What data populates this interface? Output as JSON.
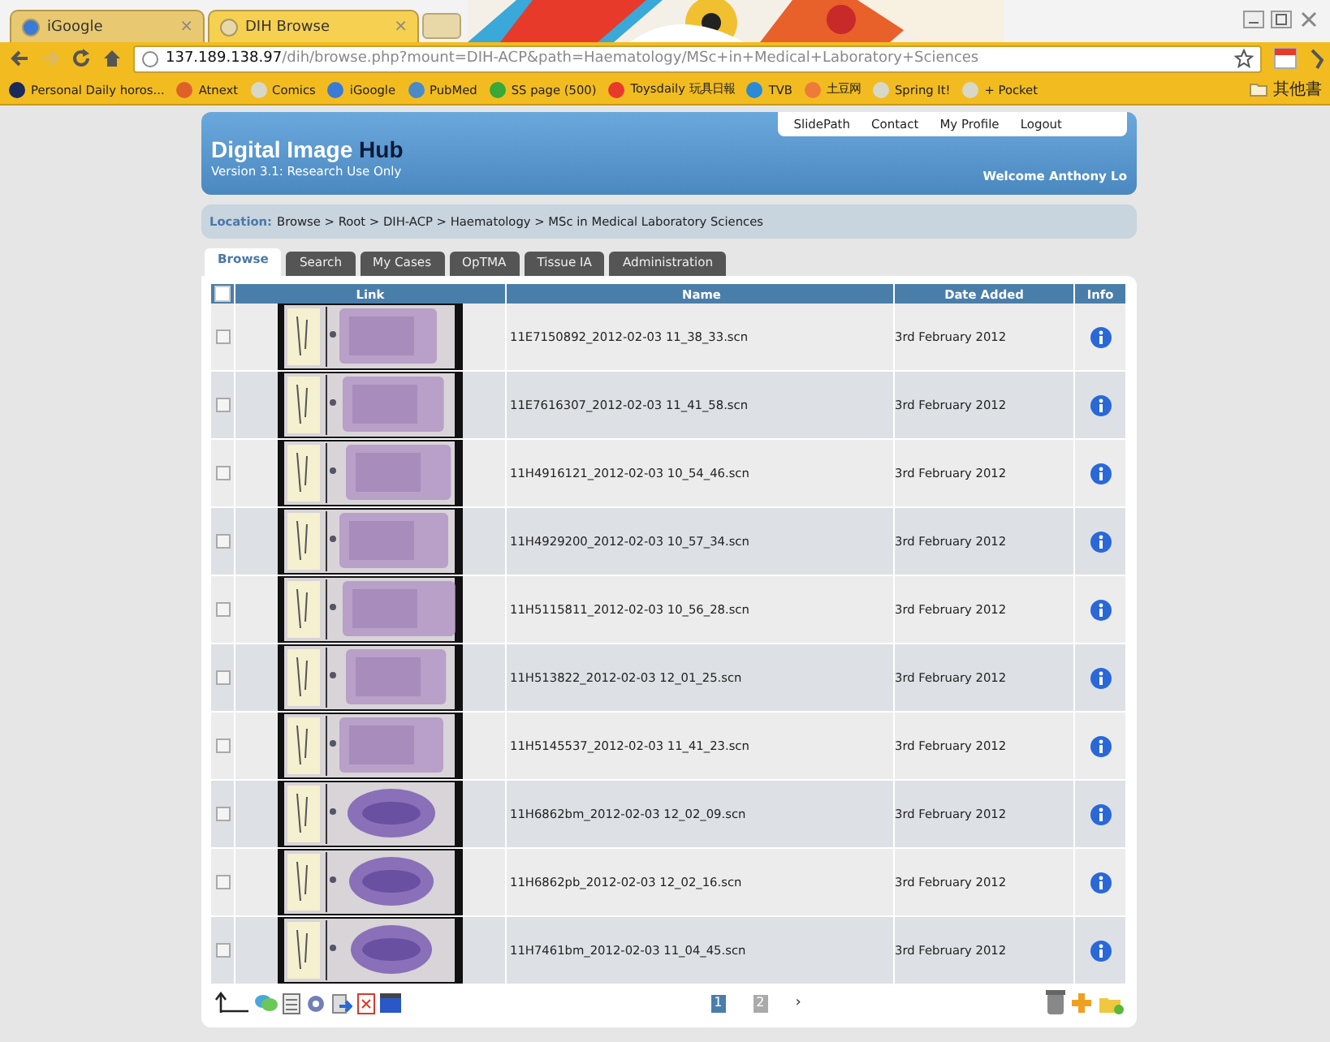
{
  "browser": {
    "tabs": [
      {
        "label": "iGoogle",
        "close": "×",
        "selected": false
      },
      {
        "label": "DIH Browse",
        "close": "×",
        "selected": true
      }
    ],
    "address": {
      "host": "137.189.138.97",
      "path": "/dih/browse.php?mount=DIH-ACP&path=Haematology/MSc+in+Medical+Laboratory+Sciences"
    },
    "bookmarks": [
      {
        "label": "Personal Daily horos...",
        "color": "#1a2a5a"
      },
      {
        "label": "Atnext",
        "color": "#e0602a"
      },
      {
        "label": "Comics",
        "color": "#d8d8c8"
      },
      {
        "label": "iGoogle",
        "color": "#3a7ad8"
      },
      {
        "label": "PubMed",
        "color": "#4a8ac8"
      },
      {
        "label": "SS page (500)",
        "color": "#38a838"
      },
      {
        "label": "Toysdaily 玩具日報",
        "color": "#e83a2a"
      },
      {
        "label": "TVB",
        "color": "#2a8ad8"
      },
      {
        "label": "土豆网",
        "color": "#f07a3a"
      },
      {
        "label": "Spring It!",
        "color": "#d8d8c8"
      },
      {
        "label": "+ Pocket",
        "color": "#d8d8c8"
      }
    ],
    "other_bookmarks": "其他書"
  },
  "header": {
    "title": "Digital Image",
    "title_bold": "Hub",
    "version": "Version 3.1: Research Use Only",
    "links": [
      "SlidePath",
      "Contact",
      "My Profile",
      "Logout"
    ],
    "welcome": "Welcome Anthony Lo"
  },
  "location": {
    "label": "Location:",
    "path": "Browse > Root > DIH-ACP > Haematology > MSc in Medical Laboratory Sciences"
  },
  "tabs": [
    {
      "label": "Browse",
      "selected": true
    },
    {
      "label": "Search",
      "selected": false
    },
    {
      "label": "My Cases",
      "selected": false
    },
    {
      "label": "OpTMA",
      "selected": false
    },
    {
      "label": "Tissue IA",
      "selected": false
    },
    {
      "label": "Administration",
      "selected": false
    }
  ],
  "table": {
    "select_all_checked": false,
    "columns": [
      "Link",
      "Name",
      "Date Added",
      "Info"
    ],
    "rows": [
      {
        "checked": false,
        "name": "11E7150892_2012-02-03 11_38_33.scn",
        "date": "3rd February 2012"
      },
      {
        "checked": false,
        "name": "11E7616307_2012-02-03 11_41_58.scn",
        "date": "3rd February 2012"
      },
      {
        "checked": false,
        "name": "11H4916121_2012-02-03 10_54_46.scn",
        "date": "3rd February 2012"
      },
      {
        "checked": false,
        "name": "11H4929200_2012-02-03 10_57_34.scn",
        "date": "3rd February 2012"
      },
      {
        "checked": false,
        "name": "11H5115811_2012-02-03 10_56_28.scn",
        "date": "3rd February 2012"
      },
      {
        "checked": false,
        "name": "11H513822_2012-02-03 12_01_25.scn",
        "date": "3rd February 2012"
      },
      {
        "checked": false,
        "name": "11H5145537_2012-02-03 11_41_23.scn",
        "date": "3rd February 2012"
      },
      {
        "checked": false,
        "name": "11H6862bm_2012-02-03 12_02_09.scn",
        "date": "3rd February 2012"
      },
      {
        "checked": false,
        "name": "11H6862pb_2012-02-03 12_02_16.scn",
        "date": "3rd February 2012"
      },
      {
        "checked": false,
        "name": "11H7461bm_2012-02-03 11_04_45.scn",
        "date": "3rd February 2012"
      }
    ]
  },
  "pagination": [
    {
      "label": "1",
      "selected": true
    },
    {
      "label": "2",
      "selected": false
    }
  ],
  "next": "›"
}
